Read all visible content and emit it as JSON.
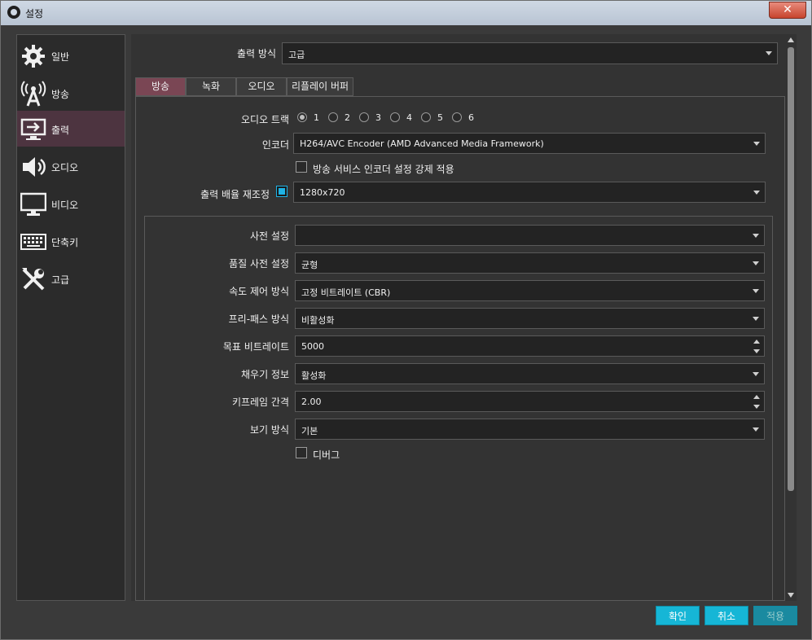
{
  "window": {
    "title": "설정",
    "close_label": "✕"
  },
  "sidebar": {
    "items": [
      {
        "label": "일반",
        "icon": "gear-icon"
      },
      {
        "label": "방송",
        "icon": "broadcast-icon"
      },
      {
        "label": "출력",
        "icon": "output-icon",
        "active": true
      },
      {
        "label": "오디오",
        "icon": "speaker-icon"
      },
      {
        "label": "비디오",
        "icon": "monitor-icon"
      },
      {
        "label": "단축키",
        "icon": "keyboard-icon"
      },
      {
        "label": "고급",
        "icon": "tools-icon"
      }
    ]
  },
  "output_mode": {
    "label": "출력 방식",
    "value": "고급"
  },
  "tabs": [
    "방송",
    "녹화",
    "오디오",
    "리플레이 버퍼"
  ],
  "audio_track": {
    "label": "오디오 트랙",
    "options": [
      "1",
      "2",
      "3",
      "4",
      "5",
      "6"
    ],
    "selected": "1"
  },
  "encoder": {
    "label": "인코더",
    "value": "H264/AVC Encoder (AMD Advanced Media Framework)"
  },
  "enforce": {
    "label": "방송 서비스 인코더 설정 강제 적용",
    "checked": false
  },
  "rescale": {
    "label": "출력 배율 재조정",
    "checked": true,
    "value": "1280x720"
  },
  "group": {
    "preset": {
      "label": "사전 설정",
      "value": ""
    },
    "quality_preset": {
      "label": "품질 사전 설정",
      "value": "균형"
    },
    "rate_control": {
      "label": "속도 제어 방식",
      "value": "고정 비트레이트 (CBR)"
    },
    "prepass": {
      "label": "프리-패스 방식",
      "value": "비활성화"
    },
    "bitrate": {
      "label": "목표 비트레이트",
      "value": "5000"
    },
    "filler": {
      "label": "채우기 정보",
      "value": "활성화"
    },
    "keyframe": {
      "label": "키프레임 간격",
      "value": "2.00"
    },
    "view": {
      "label": "보기 방식",
      "value": "기본"
    },
    "debug": {
      "label": "디버그",
      "checked": false
    }
  },
  "buttons": {
    "ok": "확인",
    "cancel": "취소",
    "apply": "적용"
  }
}
